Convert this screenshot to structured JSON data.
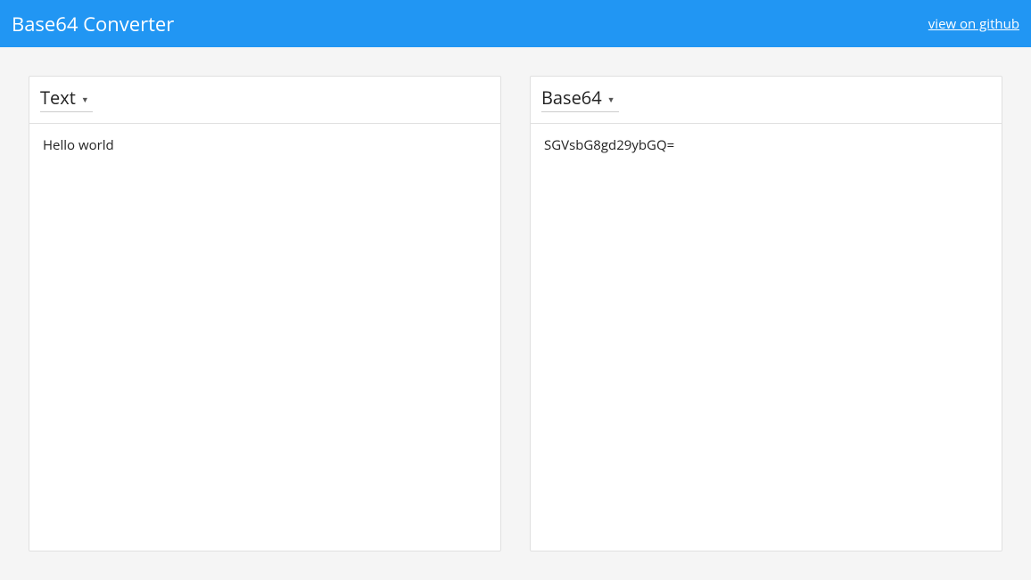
{
  "header": {
    "title": "Base64 Converter",
    "github_link": "view on github"
  },
  "panels": {
    "left": {
      "dropdown_label": "Text",
      "content": "Hello world"
    },
    "right": {
      "dropdown_label": "Base64",
      "content": "SGVsbG8gd29ybGQ="
    }
  }
}
